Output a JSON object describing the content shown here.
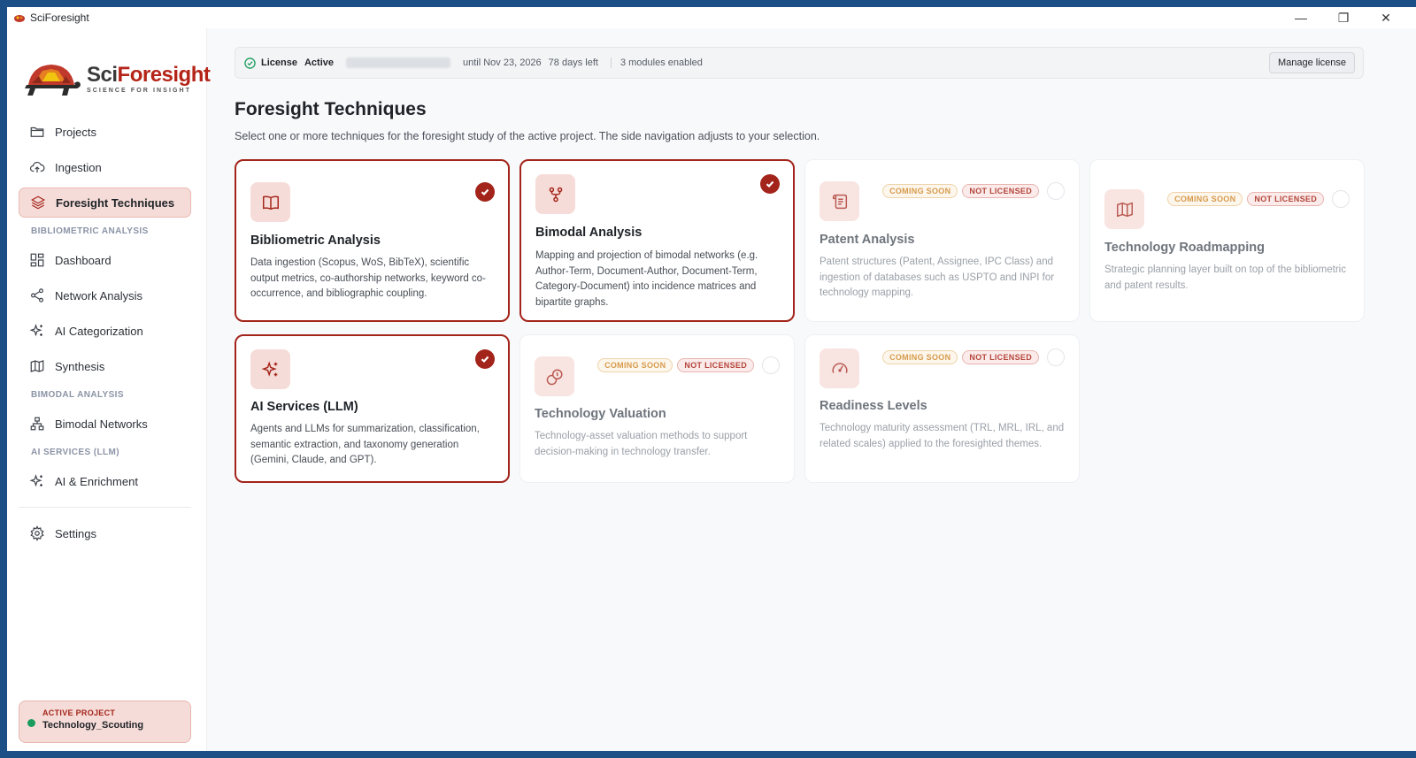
{
  "window": {
    "title": "SciForesight",
    "controls": {
      "minimize": "—",
      "restore": "❐",
      "close": "✕"
    }
  },
  "logo": {
    "name_a": "Sci",
    "name_b": "Foresight",
    "tagline": "SCIENCE FOR INSIGHT"
  },
  "sidebar": {
    "items": [
      {
        "label": "Projects",
        "icon": "folder-icon"
      },
      {
        "label": "Ingestion",
        "icon": "cloud-upload-icon"
      },
      {
        "label": "Foresight Techniques",
        "icon": "layers-icon",
        "active": true
      }
    ],
    "sections": {
      "bibliometric": {
        "title": "BIBLIOMETRIC ANALYSIS",
        "items": [
          {
            "label": "Dashboard",
            "icon": "dashboard-icon"
          },
          {
            "label": "Network Analysis",
            "icon": "share-icon"
          },
          {
            "label": "AI Categorization",
            "icon": "sparkles-icon"
          },
          {
            "label": "Synthesis",
            "icon": "map-icon"
          }
        ]
      },
      "bimodal": {
        "title": "BIMODAL ANALYSIS",
        "items": [
          {
            "label": "Bimodal Networks",
            "icon": "network-icon"
          }
        ]
      },
      "ai": {
        "title": "AI SERVICES (LLM)",
        "items": [
          {
            "label": "AI & Enrichment",
            "icon": "sparkles-icon"
          }
        ]
      }
    },
    "settings": {
      "label": "Settings",
      "icon": "gear-icon"
    },
    "active_project": {
      "label": "ACTIVE PROJECT",
      "name": "Technology_Scouting",
      "status_color": "#1a9d5c"
    }
  },
  "license": {
    "label": "License",
    "status": "Active",
    "valid_until": "until Nov 23, 2026",
    "days_left": "78 days left",
    "modules": "3 modules enabled",
    "manage_label": "Manage license"
  },
  "page": {
    "title": "Foresight Techniques",
    "subtitle": "Select one or more techniques for the foresight study of the active project. The side navigation adjusts to your selection."
  },
  "badges": {
    "coming_soon": "COMING SOON",
    "not_licensed": "NOT LICENSED"
  },
  "techniques": [
    {
      "title": "Bibliometric Analysis",
      "description": "Data ingestion (Scopus, WoS, BibTeX), scientific output metrics, co-authorship networks, keyword co-occurrence, and bibliographic coupling.",
      "icon": "book-icon",
      "selected": true
    },
    {
      "title": "Bimodal Analysis",
      "description": "Mapping and projection of bimodal networks (e.g. Author-Term, Document-Author, Document-Term, Category-Document) into incidence matrices and bipartite graphs.",
      "icon": "git-fork-icon",
      "selected": true
    },
    {
      "title": "Patent Analysis",
      "description": "Patent structures (Patent, Assignee, IPC Class) and ingestion of databases such as USPTO and INPI for technology mapping.",
      "icon": "scroll-icon",
      "selected": false
    },
    {
      "title": "Technology Roadmapping",
      "description": "Strategic planning layer built on top of the bibliometric and patent results.",
      "icon": "map-icon",
      "selected": false
    },
    {
      "title": "AI Services (LLM)",
      "description": "Agents and LLMs for summarization, classification, semantic extraction, and taxonomy generation (Gemini, Claude, and GPT).",
      "icon": "sparkles-icon",
      "selected": true
    },
    {
      "title": "Technology Valuation",
      "description": "Technology-asset valuation methods to support decision-making in technology transfer.",
      "icon": "coins-icon",
      "selected": false
    },
    {
      "title": "Readiness Levels",
      "description": "Technology maturity assessment (TRL, MRL, IRL, and related scales) applied to the foresighted themes.",
      "icon": "gauge-icon",
      "selected": false
    }
  ],
  "colors": {
    "accent": "#a3241a",
    "accent_soft": "#f6dcd8",
    "soon": "#d69b4c",
    "not_licensed": "#b4453a"
  }
}
